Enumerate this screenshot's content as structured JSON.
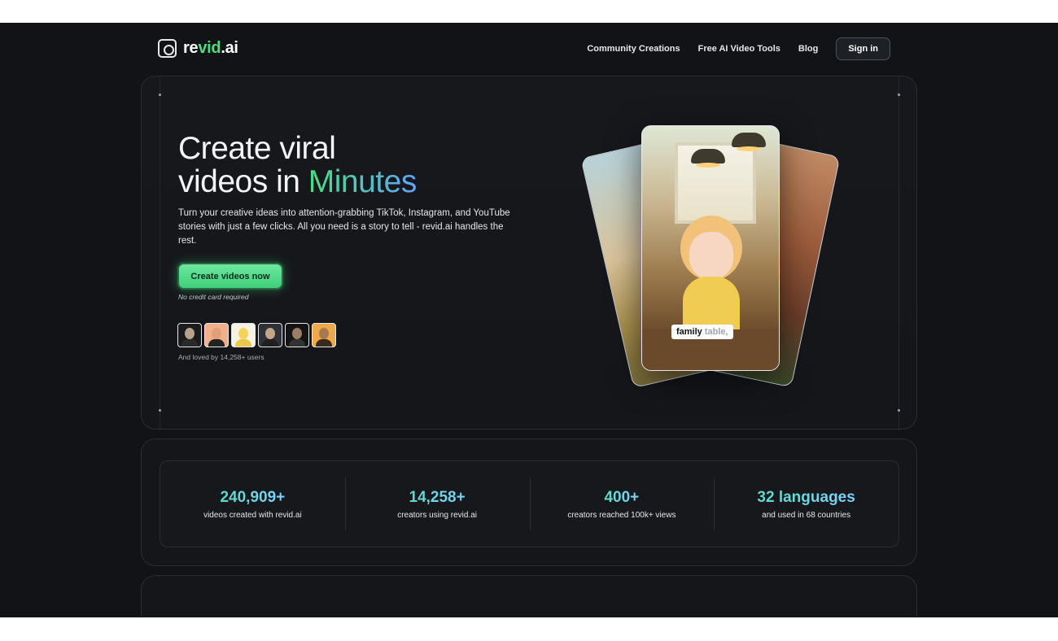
{
  "brand": {
    "name_prefix": "re",
    "name_accent": "vid",
    "name_suffix": ".ai"
  },
  "nav": {
    "links": [
      "Community Creations",
      "Free AI Video Tools",
      "Blog"
    ],
    "signin_label": "Sign in"
  },
  "hero": {
    "headline_line1": "Create viral",
    "headline_line2_prefix": "videos in ",
    "headline_line2_accent": "Minutes",
    "subtext": "Turn your creative ideas into attention-grabbing TikTok, Instagram, and YouTube stories with just a few clicks. All you need is a story to tell - revid.ai handles the rest.",
    "cta_label": "Create videos now",
    "cta_note": "No credit card required",
    "social_proof": "And loved by 14,258+ users",
    "video_caption_word1": "family",
    "video_caption_word2": " table,"
  },
  "stats": [
    {
      "value": "240,909+",
      "label": "videos created with revid.ai"
    },
    {
      "value": "14,258+",
      "label": "creators using revid.ai"
    },
    {
      "value": "400+",
      "label": "creators reached 100k+ views"
    },
    {
      "value": "32 languages",
      "label": "and used in 68 countries"
    }
  ],
  "colors": {
    "accent_green": "#4ade80",
    "accent_blue": "#60a5fa",
    "background": "#111316"
  }
}
